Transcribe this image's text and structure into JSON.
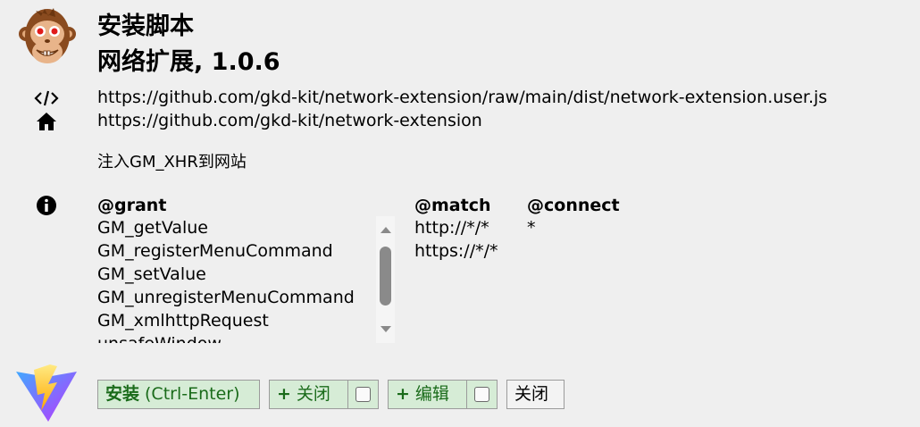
{
  "header": {
    "title": "安装脚本",
    "script_name_version": "网络扩展, 1.0.6"
  },
  "links": {
    "download_url": "https://github.com/gkd-kit/network-extension/raw/main/dist/network-extension.user.js",
    "homepage_url": "https://github.com/gkd-kit/network-extension"
  },
  "description": "注入GM_XHR到网站",
  "metadata": {
    "grant_header": "@grant",
    "grant_items": [
      "GM_getValue",
      "GM_registerMenuCommand",
      "GM_setValue",
      "GM_unregisterMenuCommand",
      "GM_xmlhttpRequest",
      "unsafeWindow"
    ],
    "match_header": "@match",
    "match_items": [
      "http://*/*",
      "https://*/*"
    ],
    "connect_header": "@connect",
    "connect_items": [
      "*"
    ]
  },
  "buttons": {
    "install_label": "安装",
    "install_shortcut": "(Ctrl-Enter)",
    "close_label": "关闭",
    "edit_label": "编辑",
    "plus_glyph": "+",
    "cancel_label": "关闭"
  },
  "colors": {
    "background": "#efefef",
    "button_green_bg": "#d6ecd6",
    "button_green_text": "#1a6b1a"
  },
  "icons": {
    "app": "monkey-logo-icon",
    "code": "code-icon",
    "home": "home-icon",
    "info": "info-icon",
    "brand": "lightning-logo-icon"
  }
}
